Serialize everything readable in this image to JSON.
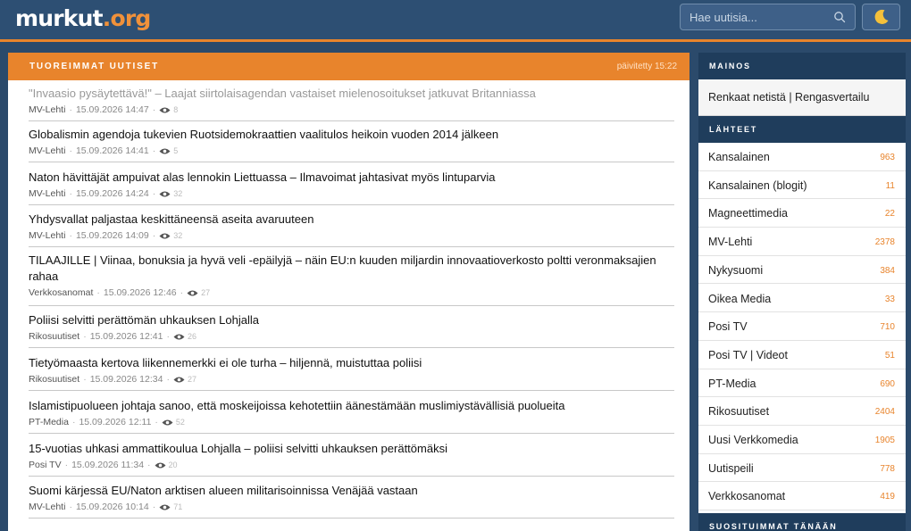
{
  "header": {
    "logo_main": "murkut",
    "logo_tld": ".org",
    "search_placeholder": "Hae uutisia...",
    "icons": {
      "search": "search-icon",
      "theme": "moon-icon"
    },
    "accent_color": "#e8842c",
    "nav_color": "#2d4f73"
  },
  "news": {
    "title": "TUOREIMMAT UUTISET",
    "updated": "päivitetty 15:22",
    "items": [
      {
        "title": "\"Invaasio pysäytettävä!\" – Laajat siirtolaisagendan vastaiset mielenosoitukset jatkuvat Britanniassa",
        "source": "MV-Lehti",
        "time": "15.09.2026 14:47",
        "views": "8",
        "visited": true
      },
      {
        "title": "Globalismin agendoja tukevien Ruotsidemokraattien vaalitulos heikoin vuoden 2014 jälkeen",
        "source": "MV-Lehti",
        "time": "15.09.2026 14:41",
        "views": "5",
        "visited": false
      },
      {
        "title": "Naton hävittäjät ampuivat alas lennokin Liettuassa – Ilmavoimat jahtasivat myös lintuparvia",
        "source": "MV-Lehti",
        "time": "15.09.2026 14:24",
        "views": "32",
        "visited": false
      },
      {
        "title": "Yhdysvallat paljastaa keskittäneensä aseita avaruuteen",
        "source": "MV-Lehti",
        "time": "15.09.2026 14:09",
        "views": "32",
        "visited": false
      },
      {
        "title": "TILAAJILLE | Viinaa, bonuksia ja hyvä veli -epäilyjä – näin EU:n kuuden miljardin innovaatioverkosto poltti veronmaksajien rahaa",
        "source": "Verkkosanomat",
        "time": "15.09.2026 12:46",
        "views": "27",
        "visited": false
      },
      {
        "title": "Poliisi selvitti perättömän uhkauksen Lohjalla",
        "source": "Rikosuutiset",
        "time": "15.09.2026 12:41",
        "views": "26",
        "visited": false
      },
      {
        "title": "Tietyömaasta kertova liikennemerkki ei ole turha – hiljennä, muistuttaa poliisi",
        "source": "Rikosuutiset",
        "time": "15.09.2026 12:34",
        "views": "27",
        "visited": false
      },
      {
        "title": "Islamistipuolueen johtaja sanoo, että moskeijoissa kehotettiin äänestämään muslimiystävällisiä puolueita",
        "source": "PT-Media",
        "time": "15.09.2026 12:11",
        "views": "52",
        "visited": false
      },
      {
        "title": "15-vuotias uhkasi ammattikoulua Lohjalla – poliisi selvitti uhkauksen perättömäksi",
        "source": "Posi TV",
        "time": "15.09.2026 11:34",
        "views": "20",
        "visited": false
      },
      {
        "title": "Suomi kärjessä EU/Naton arktisen alueen militarisoinnissa Venäjää vastaan",
        "source": "MV-Lehti",
        "time": "15.09.2026 10:14",
        "views": "71",
        "visited": false
      }
    ]
  },
  "sidebar": {
    "ad_heading": "MAINOS",
    "ad_link": "Renkaat netistä | Rengasvertailu",
    "sources_heading": "LÄHTEET",
    "sources": [
      {
        "name": "Kansalainen",
        "count": "963"
      },
      {
        "name": "Kansalainen (blogit)",
        "count": "11"
      },
      {
        "name": "Magneettimedia",
        "count": "22"
      },
      {
        "name": "MV-Lehti",
        "count": "2378"
      },
      {
        "name": "Nykysuomi",
        "count": "384"
      },
      {
        "name": "Oikea Media",
        "count": "33"
      },
      {
        "name": "Posi TV",
        "count": "710"
      },
      {
        "name": "Posi TV | Videot",
        "count": "51"
      },
      {
        "name": "PT-Media",
        "count": "690"
      },
      {
        "name": "Rikosuutiset",
        "count": "2404"
      },
      {
        "name": "Uusi Verkkomedia",
        "count": "1905"
      },
      {
        "name": "Uutispeili",
        "count": "778"
      },
      {
        "name": "Verkkosanomat",
        "count": "419"
      }
    ],
    "popular_heading": "SUOSITUIMMAT TÄNÄÄN"
  }
}
